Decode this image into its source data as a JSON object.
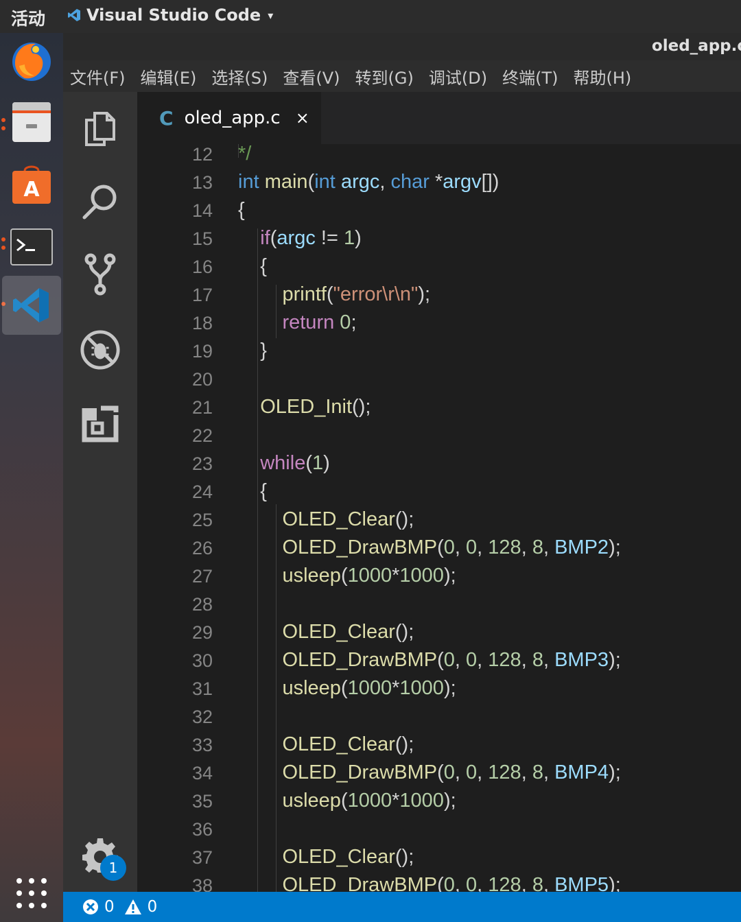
{
  "topbar": {
    "activities": "活动",
    "app_menu": "Visual Studio Code"
  },
  "window": {
    "title": "oled_app.c"
  },
  "menubar": {
    "items": [
      "文件(F)",
      "编辑(E)",
      "选择(S)",
      "查看(V)",
      "转到(G)",
      "调试(D)",
      "终端(T)",
      "帮助(H)"
    ]
  },
  "dock": {
    "items": [
      "firefox-icon",
      "files-icon",
      "software-center-icon",
      "terminal-icon",
      "vscode-icon"
    ],
    "active": "vscode-icon"
  },
  "activitybar": {
    "icons": [
      "explorer-icon",
      "search-icon",
      "source-control-icon",
      "debug-icon",
      "extensions-icon"
    ],
    "manage_badge": "1"
  },
  "tab": {
    "lang": "C",
    "filename": "oled_app.c",
    "close": "×"
  },
  "editor": {
    "line_numbers": [
      "12",
      "13",
      "14",
      "15",
      "16",
      "17",
      "18",
      "19",
      "20",
      "21",
      "22",
      "23",
      "24",
      "25",
      "26",
      "27",
      "28",
      "29",
      "30",
      "31",
      "32",
      "33",
      "34",
      "35",
      "36",
      "37",
      "38"
    ]
  },
  "statusbar": {
    "errors": "0",
    "warnings": "0"
  },
  "colors": {
    "statusbar": "#007acc",
    "keyword": "#569cd6",
    "function": "#dcdcaa",
    "control": "#c586c0",
    "string": "#ce9178",
    "number": "#b5cea8"
  }
}
